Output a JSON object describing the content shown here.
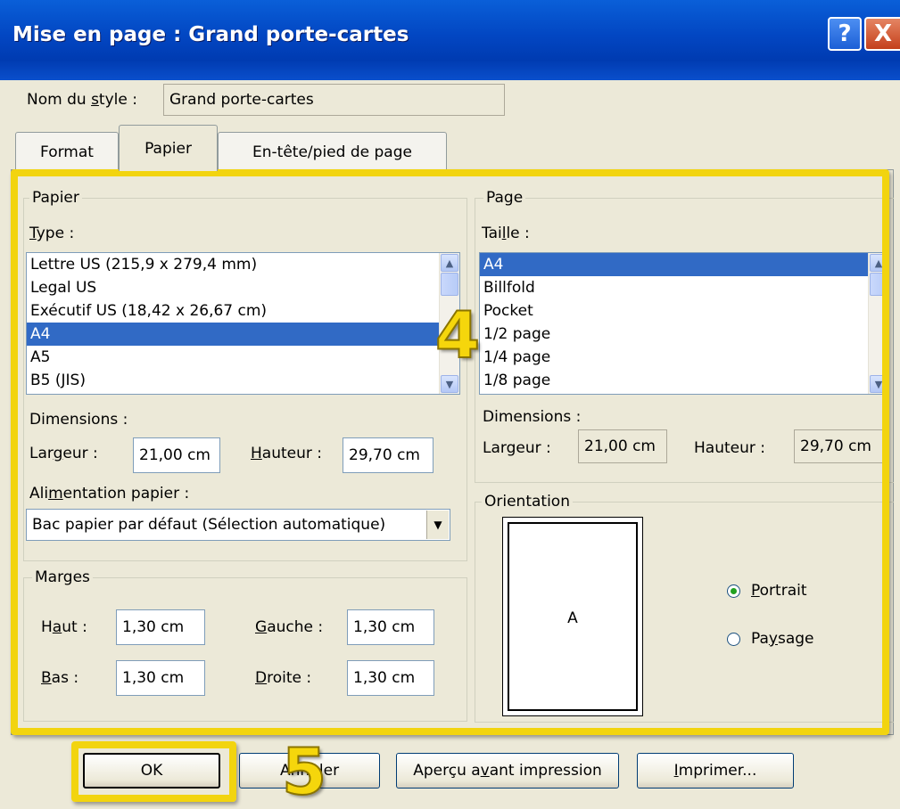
{
  "window": {
    "title": "Mise en page : Grand porte-cartes",
    "help_glyph": "?",
    "close_glyph": "X"
  },
  "style_name": {
    "label": "Nom du style :",
    "value": "Grand porte-cartes"
  },
  "tabs": [
    {
      "label": "Format",
      "active": false
    },
    {
      "label": "Papier",
      "active": true
    },
    {
      "label": "En-tête/pied de page",
      "active": false
    }
  ],
  "paper": {
    "group_label": "Papier",
    "type_label": "Type :",
    "types": [
      "Lettre US (215,9 x 279,4 mm)",
      "Legal US",
      "Exécutif US (18,42 x 26,67 cm)",
      "A4",
      "A5",
      "B5 (JIS)"
    ],
    "selected_type": "A4",
    "dimensions_label": "Dimensions :",
    "width_label": "Largeur :",
    "width_value": "21,00 cm",
    "height_label": "Hauteur :",
    "height_value": "29,70 cm",
    "feed_label": "Alimentation papier :",
    "feed_value": "Bac papier par défaut (Sélection automatique)"
  },
  "margins": {
    "group_label": "Marges",
    "top_label": "Haut :",
    "top_value": "1,30 cm",
    "left_label": "Gauche :",
    "left_value": "1,30 cm",
    "bottom_label": "Bas :",
    "bottom_value": "1,30 cm",
    "right_label": "Droite :",
    "right_value": "1,30 cm"
  },
  "page": {
    "group_label": "Page",
    "size_label": "Taille :",
    "sizes": [
      "A4",
      "Billfold",
      "Pocket",
      "1/2 page",
      "1/4 page",
      "1/8 page"
    ],
    "selected_size": "A4",
    "dimensions_label": "Dimensions :",
    "width_label": "Largeur :",
    "width_value": "21,00 cm",
    "height_label": "Hauteur :",
    "height_value": "29,70 cm"
  },
  "orientation": {
    "group_label": "Orientation",
    "preview_letter": "A",
    "options": [
      {
        "label": "Portrait",
        "selected": true
      },
      {
        "label": "Paysage",
        "selected": false
      }
    ]
  },
  "buttons": {
    "ok": "OK",
    "cancel": "Annuler",
    "preview": "Aperçu avant impression",
    "print": "Imprimer..."
  },
  "annotations": {
    "step4": "4",
    "step5": "5",
    "highlight_color": "#f2d40f"
  },
  "colors": {
    "titlebar": "#0246c2",
    "selection": "#316ac5",
    "dialog_bg": "#ece9d8"
  }
}
